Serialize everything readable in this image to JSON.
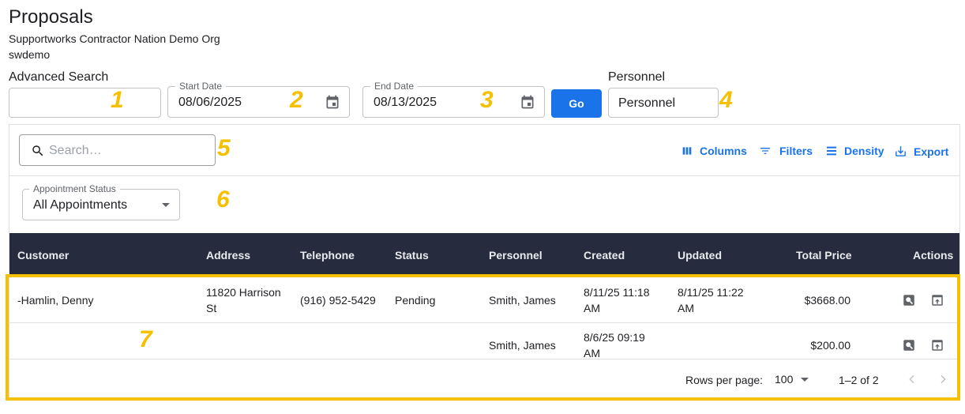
{
  "header": {
    "title": "Proposals",
    "org": "Supportworks Contractor Nation Demo Org",
    "user": "swdemo"
  },
  "filters": {
    "advanced_search_label": "Advanced Search",
    "start_date_label": "Start Date",
    "start_date_value": "08/06/2025",
    "end_date_label": "End Date",
    "end_date_value": "08/13/2025",
    "go_label": "Go",
    "personnel_label": "Personnel",
    "personnel_value": "Personnel"
  },
  "toolbar": {
    "search_placeholder": "Search…",
    "columns_label": "Columns",
    "filters_label": "Filters",
    "density_label": "Density",
    "export_label": "Export"
  },
  "appointment_status": {
    "label": "Appointment Status",
    "value": "All Appointments"
  },
  "table": {
    "columns": [
      "Customer",
      "Address",
      "Telephone",
      "Status",
      "Personnel",
      "Created",
      "Updated",
      "Total Price",
      "Actions"
    ],
    "rows": [
      {
        "customer": "-Hamlin, Denny",
        "address_line1": "11820 Harrison",
        "address_line2": "St",
        "telephone": "(916) 952-5429",
        "status": "Pending",
        "personnel": "Smith, James",
        "created_line1": "8/11/25 11:18",
        "created_line2": "AM",
        "updated_line1": "8/11/25 11:22",
        "updated_line2": "AM",
        "total_price": "$3668.00"
      },
      {
        "customer": "",
        "address_line1": "",
        "address_line2": "",
        "telephone": "",
        "status": "",
        "personnel": "Smith, James",
        "created_line1": "8/6/25 09:19",
        "created_line2": "AM",
        "updated_line1": "",
        "updated_line2": "",
        "total_price": "$200.00"
      }
    ]
  },
  "pagination": {
    "rows_per_page_label": "Rows per page:",
    "rows_per_page_value": "100",
    "range": "1–2 of 2"
  },
  "annotations": [
    "1",
    "2",
    "3",
    "4",
    "5",
    "6",
    "7"
  ],
  "colors": {
    "primary": "#1a73e8",
    "header_bg": "#262b3e",
    "highlight": "#f5c000"
  }
}
